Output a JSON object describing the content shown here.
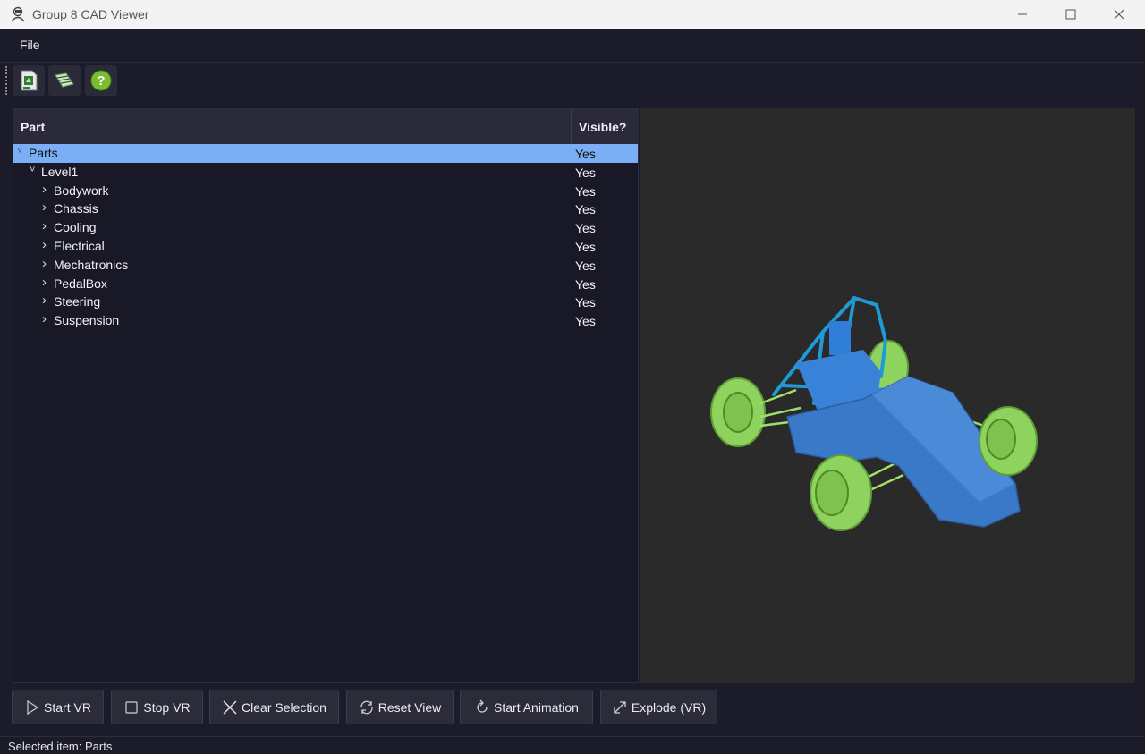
{
  "window": {
    "title": "Group 8 CAD Viewer"
  },
  "menu": {
    "file": "File"
  },
  "toolbar": {
    "icons": [
      "open-file-icon",
      "load-parts-icon",
      "help-icon"
    ]
  },
  "tree": {
    "columns": {
      "part": "Part",
      "visible": "Visible?"
    },
    "rows": [
      {
        "label": "Parts",
        "visible": "Yes",
        "level": 0,
        "expanded": true,
        "selected": true
      },
      {
        "label": "Level1",
        "visible": "Yes",
        "level": 1,
        "expanded": true
      },
      {
        "label": "Bodywork",
        "visible": "Yes",
        "level": 2,
        "expanded": false
      },
      {
        "label": "Chassis",
        "visible": "Yes",
        "level": 2,
        "expanded": false
      },
      {
        "label": "Cooling",
        "visible": "Yes",
        "level": 2,
        "expanded": false
      },
      {
        "label": "Electrical",
        "visible": "Yes",
        "level": 2,
        "expanded": false
      },
      {
        "label": "Mechatronics",
        "visible": "Yes",
        "level": 2,
        "expanded": false
      },
      {
        "label": "PedalBox",
        "visible": "Yes",
        "level": 2,
        "expanded": false
      },
      {
        "label": "Steering",
        "visible": "Yes",
        "level": 2,
        "expanded": false
      },
      {
        "label": "Suspension",
        "visible": "Yes",
        "level": 2,
        "expanded": false
      }
    ]
  },
  "buttons": {
    "start_vr": "Start VR",
    "stop_vr": "Stop VR",
    "clear_selection": "Clear Selection",
    "reset_view": "Reset View",
    "start_animation": "Start Animation",
    "explode_vr": "Explode (VR)"
  },
  "status": {
    "message": "Selected item: Parts"
  },
  "colors": {
    "selection": "#7aaef5",
    "body": "#3a78c8",
    "wheels": "#8fd35f",
    "frame": "#1f9ad6"
  }
}
